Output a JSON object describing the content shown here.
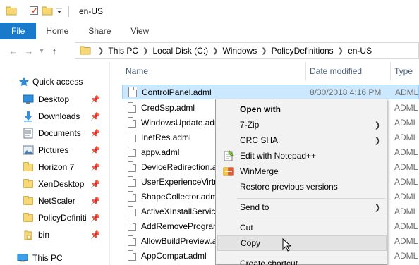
{
  "window": {
    "title": "en-US",
    "quick_access_toolbar": [
      "properties-icon",
      "new-folder-icon",
      "customize-dropdown-icon"
    ]
  },
  "ribbon": {
    "tabs": [
      "File",
      "Home",
      "Share",
      "View"
    ]
  },
  "address": {
    "path": [
      "This PC",
      "Local Disk (C:)",
      "Windows",
      "PolicyDefinitions",
      "en-US"
    ]
  },
  "nav": {
    "quick_access": "Quick access",
    "items": [
      {
        "label": "Desktop",
        "icon": "desktop-icon",
        "pinned": true
      },
      {
        "label": "Downloads",
        "icon": "downloads-icon",
        "pinned": true
      },
      {
        "label": "Documents",
        "icon": "documents-icon",
        "pinned": true
      },
      {
        "label": "Pictures",
        "icon": "pictures-icon",
        "pinned": true
      },
      {
        "label": "Horizon 7",
        "icon": "folder-icon",
        "pinned": true
      },
      {
        "label": "XenDesktop",
        "icon": "folder-icon",
        "pinned": true
      },
      {
        "label": "NetScaler",
        "icon": "folder-icon",
        "pinned": true
      },
      {
        "label": "PolicyDefiniti",
        "icon": "folder-icon",
        "pinned": true
      },
      {
        "label": "bin",
        "icon": "folder-icon",
        "pinned": true
      }
    ],
    "this_pc": "This PC"
  },
  "files": {
    "columns": {
      "name": "Name",
      "date": "Date modified",
      "type": "Type"
    },
    "rows": [
      {
        "name": "ControlPanel.adml",
        "date": "8/30/2018 4:16 PM",
        "type": "ADML",
        "selected": true
      },
      {
        "name": "CredSsp.adml",
        "date": "",
        "type": "ADML"
      },
      {
        "name": "WindowsUpdate.adml",
        "date": "",
        "type": "ADML"
      },
      {
        "name": "InetRes.adml",
        "date": "",
        "type": "ADML"
      },
      {
        "name": "appv.adml",
        "date": "",
        "type": "ADML"
      },
      {
        "name": "DeviceRedirection.adml",
        "date": "",
        "type": "ADML"
      },
      {
        "name": "UserExperienceVirtualization.adml",
        "date": "",
        "type": "ADML"
      },
      {
        "name": "ShapeCollector.adml",
        "date": "",
        "type": "ADML"
      },
      {
        "name": "ActiveXInstallService.adml",
        "date": "",
        "type": "ADML"
      },
      {
        "name": "AddRemovePrograms.adml",
        "date": "",
        "type": "ADML"
      },
      {
        "name": "AllowBuildPreview.adml",
        "date": "",
        "type": "ADML"
      },
      {
        "name": "AppCompat.adml",
        "date": "",
        "type": "ADML"
      }
    ]
  },
  "context_menu": {
    "items": [
      {
        "label": "Open with",
        "bold": true
      },
      {
        "label": "7-Zip",
        "submenu": true
      },
      {
        "label": "CRC SHA",
        "submenu": true
      },
      {
        "label": "Edit with Notepad++",
        "icon": "notepadpp-icon"
      },
      {
        "label": "WinMerge",
        "icon": "winmerge-icon"
      },
      {
        "label": "Restore previous versions"
      },
      {
        "label": "Send to",
        "submenu": true
      },
      {
        "label": "Cut"
      },
      {
        "label": "Copy",
        "hover": true
      },
      {
        "label": "Create shortcut"
      }
    ]
  },
  "colors": {
    "file_tab": "#1979ca",
    "selection": "#cce8ff",
    "selection_border": "#99d1ff",
    "menu_bg": "#f2f2f2"
  }
}
